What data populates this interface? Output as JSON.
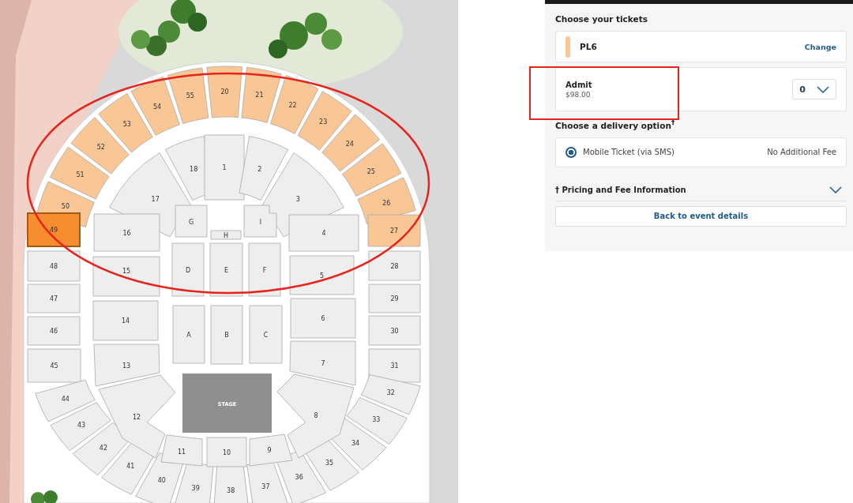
{
  "seat_map": {
    "stage": "STAGE",
    "sections": [
      {
        "label": "50",
        "available": true,
        "selected": false
      },
      {
        "label": "51",
        "available": true,
        "selected": false
      },
      {
        "label": "52",
        "available": true,
        "selected": false
      },
      {
        "label": "53",
        "available": true,
        "selected": false
      },
      {
        "label": "54",
        "available": true,
        "selected": false
      },
      {
        "label": "55",
        "available": true,
        "selected": false
      },
      {
        "label": "20",
        "available": true,
        "selected": false
      },
      {
        "label": "21",
        "available": true,
        "selected": false
      },
      {
        "label": "22",
        "available": true,
        "selected": false
      },
      {
        "label": "23",
        "available": true,
        "selected": false
      },
      {
        "label": "24",
        "available": true,
        "selected": false
      },
      {
        "label": "25",
        "available": true,
        "selected": false
      },
      {
        "label": "26",
        "available": true,
        "selected": false
      },
      {
        "label": "49",
        "available": true,
        "selected": true
      },
      {
        "label": "27",
        "available": true,
        "selected": false
      },
      {
        "label": "48",
        "available": false,
        "selected": false
      },
      {
        "label": "28",
        "available": false,
        "selected": false
      },
      {
        "label": "47",
        "available": false,
        "selected": false
      },
      {
        "label": "29",
        "available": false,
        "selected": false
      },
      {
        "label": "46",
        "available": false,
        "selected": false
      },
      {
        "label": "30",
        "available": false,
        "selected": false
      },
      {
        "label": "45",
        "available": false,
        "selected": false
      },
      {
        "label": "31",
        "available": false,
        "selected": false
      },
      {
        "label": "44",
        "available": false,
        "selected": false
      },
      {
        "label": "43",
        "available": false,
        "selected": false
      },
      {
        "label": "42",
        "available": false,
        "selected": false
      },
      {
        "label": "41",
        "available": false,
        "selected": false
      },
      {
        "label": "40",
        "available": false,
        "selected": false
      },
      {
        "label": "39",
        "available": false,
        "selected": false
      },
      {
        "label": "38",
        "available": false,
        "selected": false
      },
      {
        "label": "37",
        "available": false,
        "selected": false
      },
      {
        "label": "36",
        "available": false,
        "selected": false
      },
      {
        "label": "35",
        "available": false,
        "selected": false
      },
      {
        "label": "34",
        "available": false,
        "selected": false
      },
      {
        "label": "33",
        "available": false,
        "selected": false
      },
      {
        "label": "32",
        "available": false,
        "selected": false
      },
      {
        "label": "17",
        "available": false,
        "selected": false
      },
      {
        "label": "18",
        "available": false,
        "selected": false
      },
      {
        "label": "1",
        "available": false,
        "selected": false
      },
      {
        "label": "2",
        "available": false,
        "selected": false
      },
      {
        "label": "3",
        "available": false,
        "selected": false
      },
      {
        "label": "16",
        "available": false,
        "selected": false
      },
      {
        "label": "4",
        "available": false,
        "selected": false
      },
      {
        "label": "15",
        "available": false,
        "selected": false
      },
      {
        "label": "5",
        "available": false,
        "selected": false
      },
      {
        "label": "14",
        "available": false,
        "selected": false
      },
      {
        "label": "6",
        "available": false,
        "selected": false
      },
      {
        "label": "13",
        "available": false,
        "selected": false
      },
      {
        "label": "7",
        "available": false,
        "selected": false
      },
      {
        "label": "12",
        "available": false,
        "selected": false
      },
      {
        "label": "8",
        "available": false,
        "selected": false
      },
      {
        "label": "11",
        "available": false,
        "selected": false
      },
      {
        "label": "10",
        "available": false,
        "selected": false
      },
      {
        "label": "9",
        "available": false,
        "selected": false
      },
      {
        "label": "G",
        "available": false,
        "selected": false
      },
      {
        "label": "H",
        "available": false,
        "selected": false
      },
      {
        "label": "I",
        "available": false,
        "selected": false
      },
      {
        "label": "D",
        "available": false,
        "selected": false
      },
      {
        "label": "E",
        "available": false,
        "selected": false
      },
      {
        "label": "F",
        "available": false,
        "selected": false
      },
      {
        "label": "A",
        "available": false,
        "selected": false
      },
      {
        "label": "B",
        "available": false,
        "selected": false
      },
      {
        "label": "C",
        "available": false,
        "selected": false
      }
    ]
  },
  "tickets": {
    "heading": "Choose your tickets",
    "section": {
      "name": "PL6",
      "color": "#f8c594",
      "link": "Change"
    },
    "ticket_type": {
      "name": "Admit",
      "price": "$98.00",
      "quantity": "0"
    }
  },
  "delivery": {
    "heading": "Choose a delivery option$^{†}$",
    "options": [
      {
        "label": "Mobile Ticket (via SMS)",
        "fee": "No Additional Fee",
        "selected": true
      }
    ]
  },
  "pricing_info": {
    "label": "† Pricing and Fee Information",
    "expanded": false
  },
  "back_button": "Back to event details"
}
